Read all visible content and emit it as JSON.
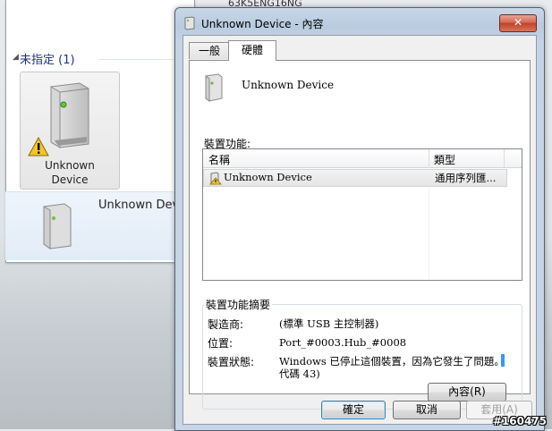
{
  "background": {
    "top_text": "63K5ENG16NG",
    "group_header": "未指定 (1)",
    "tile_label_line1": "Unknown",
    "tile_label_line2": "Device",
    "row_label": "Unknown Devi"
  },
  "dialog": {
    "title": "Unknown Device - 內容",
    "close_glyph": "✕",
    "tabs": [
      {
        "label": "一般",
        "selected": false
      },
      {
        "label": "硬體",
        "selected": true
      }
    ],
    "device_name": "Unknown Device",
    "functions_label": "裝置功能:",
    "columns": {
      "name": "名稱",
      "type": "類型"
    },
    "rows": [
      {
        "name": "Unknown Device",
        "type": "通用序列匯..."
      }
    ],
    "summary_title": "裝置功能摘要",
    "manufacturer_label": "製造商:",
    "manufacturer_value": "(標準 USB 主控制器)",
    "location_label": "位置:",
    "location_value": "Port_#0003.Hub_#0008",
    "status_label": "裝置狀態:",
    "status_line1": "Windows 已停止這個裝置，因為它發生了問題。",
    "status_line2": "代碼 43)",
    "properties_button": "內容(R)",
    "buttons": {
      "ok": "確定",
      "cancel": "取消",
      "apply": "套用(A)"
    }
  },
  "watermark": "#160475",
  "colors": {
    "group_header": "#1e3287",
    "close_red": "#c2412a",
    "default_button": "#3c7fb1"
  },
  "icons": [
    "device-icon",
    "warning-icon",
    "close-icon",
    "chevron-down-icon"
  ]
}
